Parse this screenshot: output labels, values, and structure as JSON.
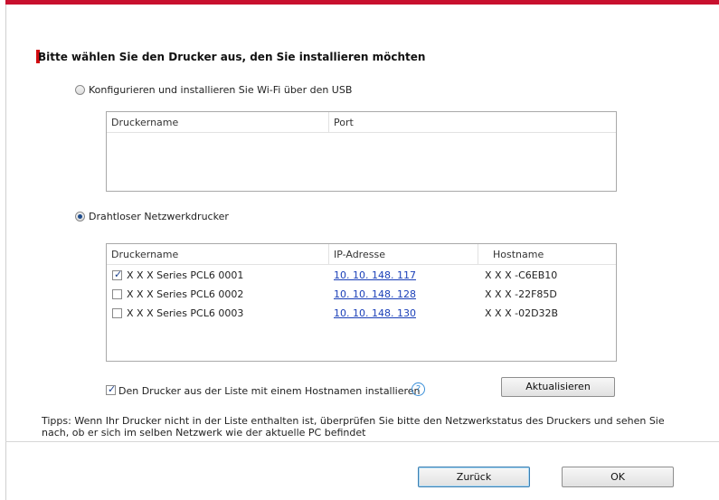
{
  "heading": "Bitte wählen Sie den Drucker aus, den Sie installieren möchten",
  "usb_option": {
    "label": "Konfigurieren und installieren Sie Wi-Fi über den USB",
    "selected": false,
    "table": {
      "columns": [
        "Druckername",
        "Port"
      ],
      "rows": []
    }
  },
  "wireless_option": {
    "label": "Drahtloser Netzwerkdrucker",
    "selected": true,
    "table": {
      "columns": [
        "Druckername",
        "IP-Adresse",
        "Hostname"
      ],
      "rows": [
        {
          "checked": true,
          "name": "X X X  Series PCL6 0001",
          "ip": "10. 10. 148. 117",
          "hostname": "X X X -C6EB10"
        },
        {
          "checked": false,
          "name": "X X X  Series PCL6 0002",
          "ip": "10. 10. 148. 128",
          "hostname": "X X X -22F85D"
        },
        {
          "checked": false,
          "name": "X X X  Series PCL6 0003",
          "ip": "10. 10. 148. 130",
          "hostname": "X X X -02D32B"
        }
      ]
    }
  },
  "hostname_install": {
    "label": "Den Drucker aus der Liste mit einem Hostnamen installieren",
    "checked": true,
    "help_symbol": "?"
  },
  "refresh_button": "Aktualisieren",
  "tips": "Tipps: Wenn Ihr Drucker nicht in der Liste enthalten ist, überprüfen Sie bitte den Netzwerkstatus des Druckers und sehen Sie nach, ob er sich im selben Netzwerk wie der aktuelle PC befindet",
  "back_button": "Zurück",
  "ok_button": "OK",
  "colors": {
    "accent": "#c8102e",
    "link": "#1a3fb8"
  }
}
